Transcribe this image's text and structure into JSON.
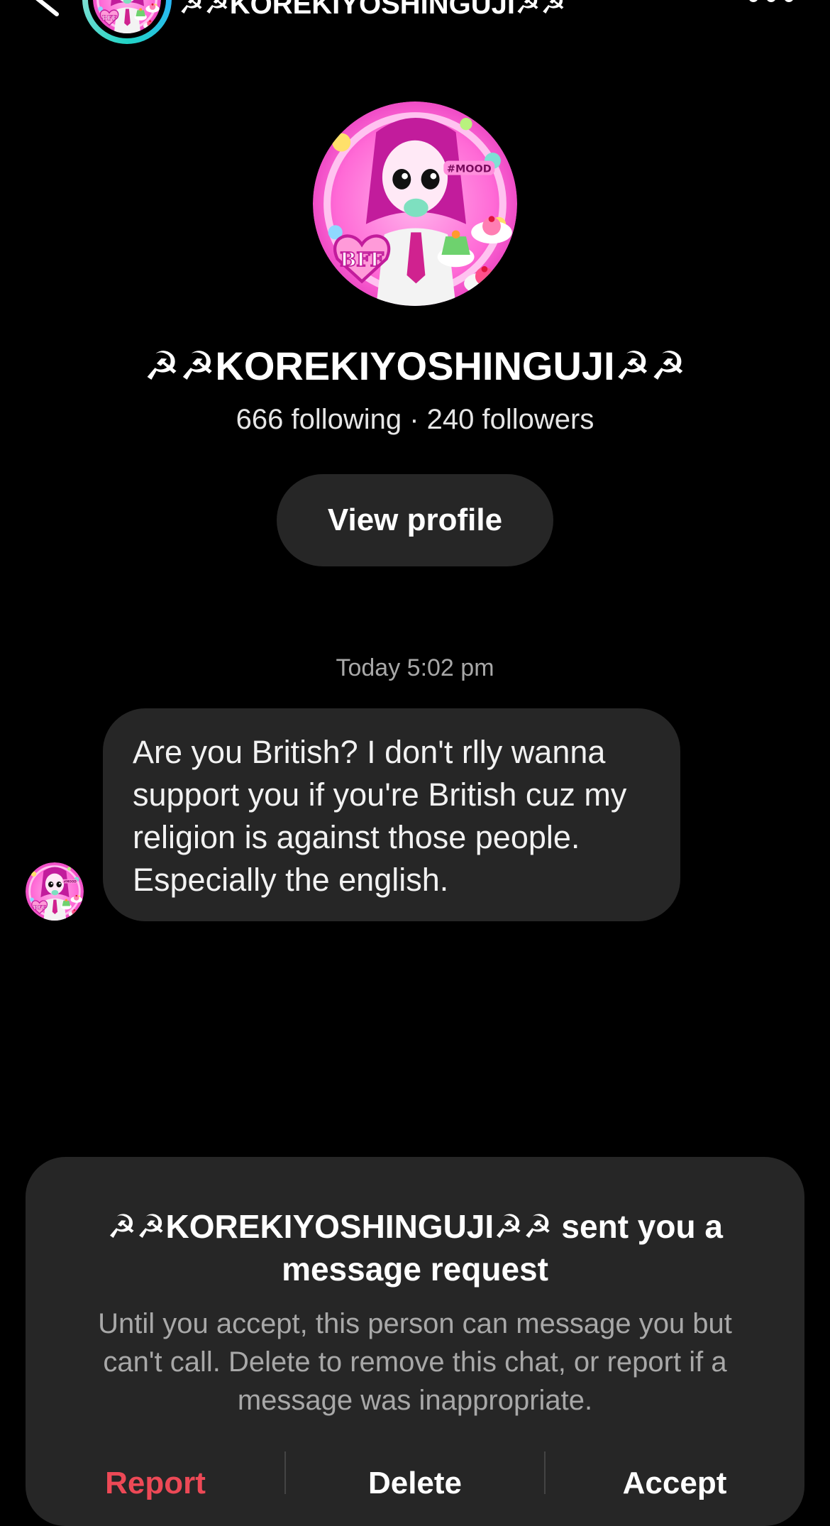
{
  "header": {
    "back_icon": "chevron-left-icon",
    "username": "☭☭KOREKIYOSHINGUJI☭☭",
    "more_icon": "more-horizontal-icon"
  },
  "profile": {
    "display_name": "☭☭KOREKIYOSHINGUJI☭☭",
    "stats": "666 following · 240 followers",
    "view_profile_label": "View profile",
    "avatar_sticker_text": "BFF",
    "avatar_tag_text": "#MOOD"
  },
  "conversation": {
    "timestamp": "Today 5:02 pm",
    "messages": [
      {
        "text": "Are you British? I don't rlly wanna support you if you're British cuz my religion is against those people. Especially the english."
      }
    ]
  },
  "request": {
    "title": "☭☭KOREKIYOSHINGUJI☭☭ sent you a message request",
    "description": "Until you accept, this person can message you but can't call. Delete to remove this chat, or report if a message was inappropriate.",
    "actions": {
      "report": "Report",
      "delete": "Delete",
      "accept": "Accept"
    }
  },
  "colors": {
    "background": "#000000",
    "bubble": "#262626",
    "report": "#ed4956",
    "story_ring": "#22d3c5",
    "avatar_pink": "#ff5fd2"
  }
}
